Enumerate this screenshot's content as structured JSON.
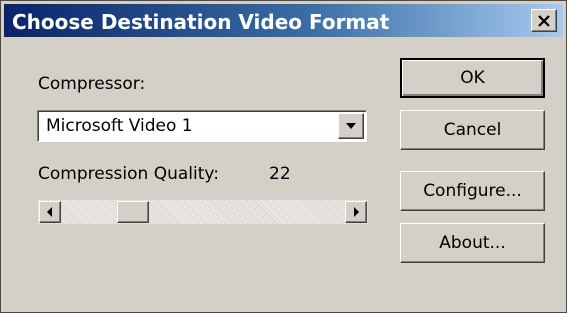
{
  "window": {
    "title": "Choose Destination Video Format",
    "close_label": "×"
  },
  "compressor": {
    "label": "Compressor:",
    "selected": "Microsoft Video 1"
  },
  "quality": {
    "label": "Compression Quality:",
    "value": "22",
    "level_fraction": 0.22
  },
  "buttons": {
    "ok": "OK",
    "cancel": "Cancel",
    "configure": "Configure...",
    "about": "About..."
  },
  "icons": {
    "close": "close-icon",
    "dropdown": "chevron-down-icon",
    "scroll_left": "arrow-left-icon",
    "scroll_right": "arrow-right-icon"
  },
  "colors": {
    "title_gradient_start": "#0a246a",
    "title_gradient_end": "#a6caf0",
    "face": "#d4d0c8"
  }
}
